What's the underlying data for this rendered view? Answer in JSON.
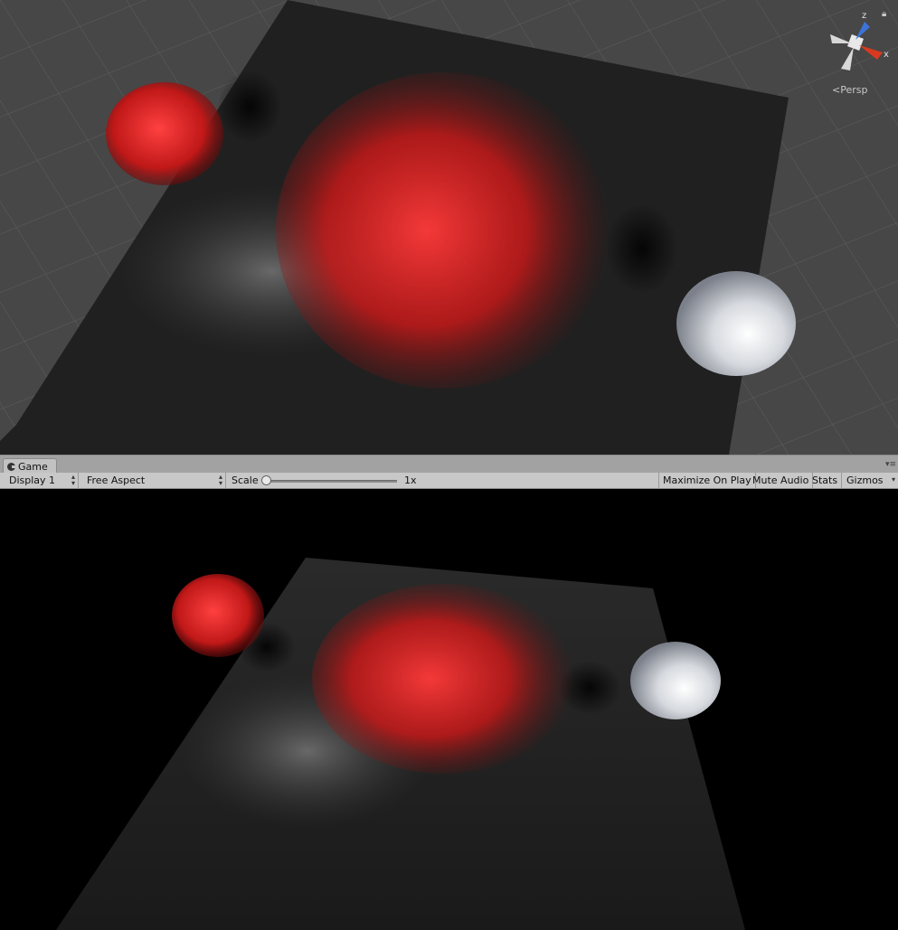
{
  "scene": {
    "projection_label": "Persp",
    "axis_labels": {
      "z": "z",
      "x": "x"
    },
    "icons": [
      "lock-icon",
      "orientation-gizmo-icon",
      "perspective-icon"
    ]
  },
  "game_tab": {
    "label": "Game",
    "icon": "game-icon",
    "menu_icon": "tab-menu-icon"
  },
  "toolbar": {
    "display": "Display 1",
    "aspect": "Free Aspect",
    "scale_label": "Scale",
    "scale_value": "1x",
    "scale_slider_fraction": 0.0,
    "maximize_on_play": "Maximize On Play",
    "mute_audio": "Mute Audio",
    "stats": "Stats",
    "gizmos": "Gizmos"
  },
  "colors": {
    "scene_bg": "#474747",
    "plane": "#1e1e1e",
    "fire": "#e8262a",
    "sphere": "#e6e8ec",
    "axis_x": "#d9391f",
    "axis_z": "#3b74d9"
  }
}
